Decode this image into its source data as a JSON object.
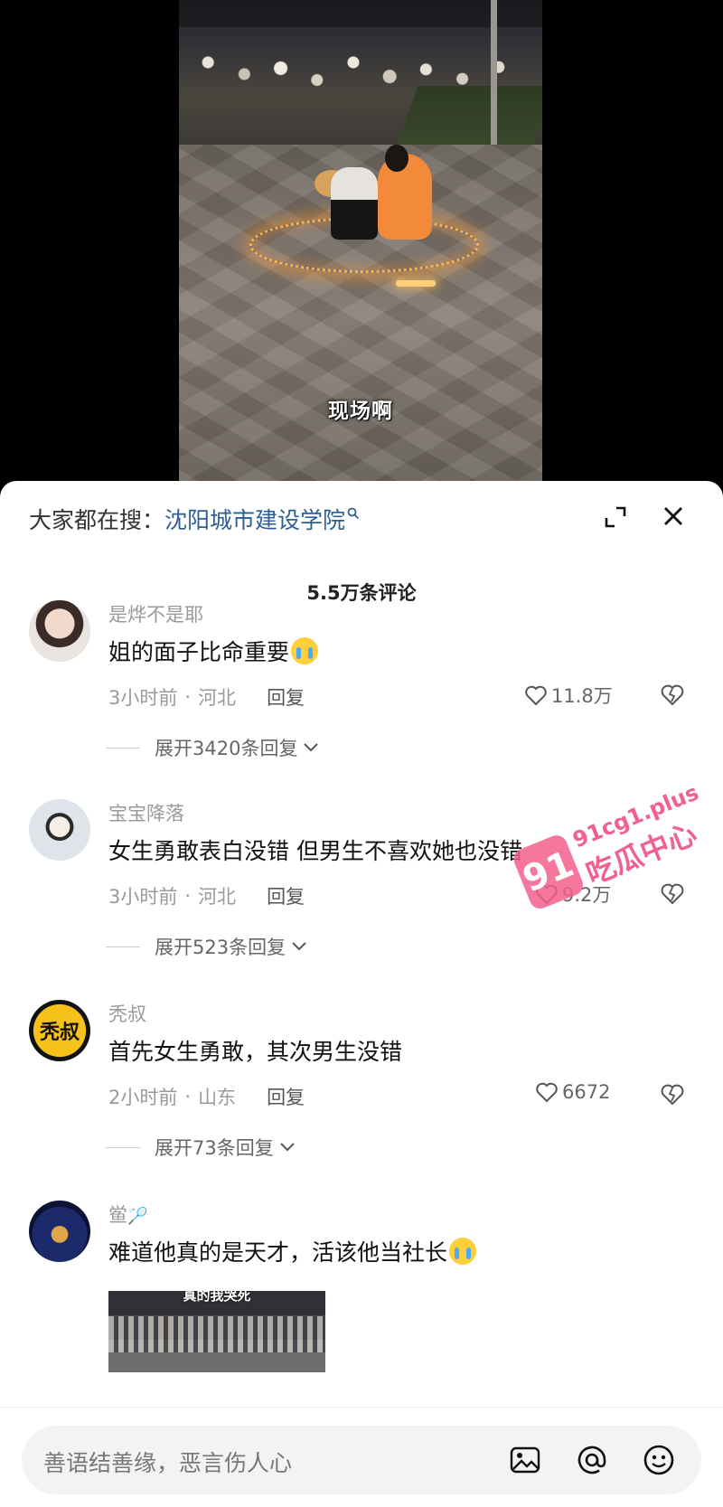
{
  "video": {
    "subtitle": "现场啊"
  },
  "sheet": {
    "search_prefix": "大家都在搜：",
    "search_term": "沈阳城市建设学院",
    "comment_count": "5.5万条评论"
  },
  "comments": [
    {
      "user": "是烨不是耶",
      "text": "姐的面子比命重要",
      "time": "3小时前",
      "location": "河北",
      "reply_label": "回复",
      "likes": "11.8万",
      "expand": "展开3420条回复"
    },
    {
      "user": "宝宝降落",
      "text": "女生勇敢表白没错 但男生不喜欢她也没错",
      "time": "3小时前",
      "location": "河北",
      "reply_label": "回复",
      "likes": "9.2万",
      "expand": "展开523条回复"
    },
    {
      "user": "秃叔",
      "avatar_text": "秃叔",
      "text": "首先女生勇敢，其次男生没错",
      "time": "2小时前",
      "location": "山东",
      "reply_label": "回复",
      "likes": "6672",
      "expand": "展开73条回复"
    },
    {
      "user": "鲎",
      "text": "难道他真的是天才，活该他当社长",
      "thumb_text": "真的我哭死"
    }
  ],
  "watermark": {
    "badge": "91",
    "url": "91cg1.plus",
    "name": "吃瓜中心"
  },
  "input": {
    "placeholder": "善语结善缘，恶言伤人心"
  }
}
